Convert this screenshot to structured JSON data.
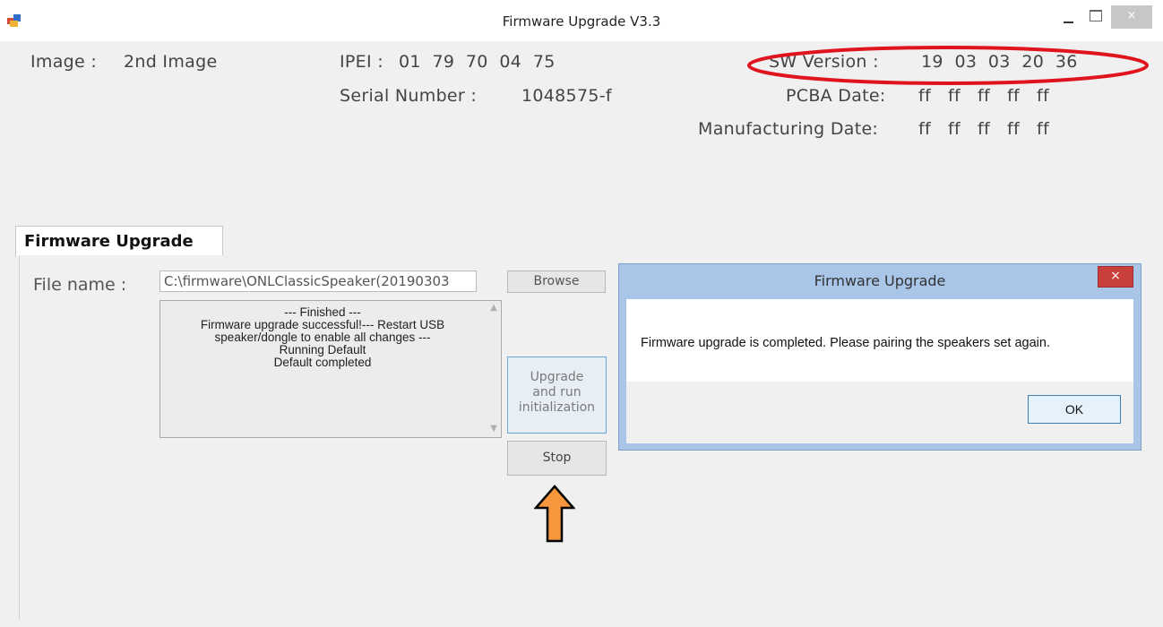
{
  "window": {
    "title": "Firmware Upgrade V3.3",
    "close_symbol": "×",
    "icon": "app-icon"
  },
  "device_info": {
    "image_label": "Image :",
    "image_value": "2nd Image",
    "ipei_label": "IPEI :",
    "ipei_value": "01  79  70  04  75",
    "serial_label": "Serial Number :",
    "serial_value": "1048575-f",
    "sw_version_label": "SW Version :",
    "sw_version_value": "19  03  03  20  36",
    "pcba_date_label": "PCBA Date:",
    "pcba_date_value": "ff   ff   ff   ff   ff",
    "mfg_date_label": "Manufacturing Date:",
    "mfg_date_value": "ff   ff   ff   ff   ff"
  },
  "tabs": [
    {
      "label": "Firmware Upgrade",
      "selected": true
    }
  ],
  "upgrade_panel": {
    "file_label": "File name :",
    "file_value": "C:\\firmware\\ONLClassicSpeaker(20190303",
    "browse_label": "Browse",
    "upgrade_label": "Upgrade and run initialization",
    "stop_label": "Stop",
    "log_text": "--- Finished ---\nFirmware upgrade successful!--- Restart USB speaker/dongle to enable all changes ---\nRunning Default\nDefault completed"
  },
  "dialog": {
    "title": "Firmware Upgrade",
    "message": "Firmware upgrade is completed. Please pairing the speakers set again.",
    "ok_label": "OK",
    "close_symbol": "×"
  },
  "annotations": {
    "highlight_color": "#e0141e",
    "arrow_color": "#f7963c"
  }
}
